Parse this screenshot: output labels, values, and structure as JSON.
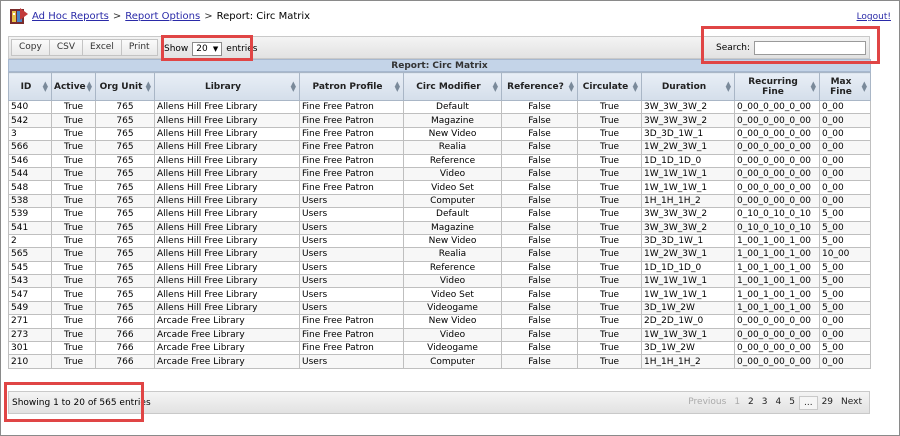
{
  "header": {
    "crumb_1": "Ad Hoc Reports",
    "sep_1": ">",
    "crumb_2": "Report Options",
    "sep_2": ">",
    "crumb_3": "Report: Circ Matrix",
    "logout": "Logout!"
  },
  "toolbar": {
    "buttons": [
      "Copy",
      "CSV",
      "Excel",
      "Print"
    ],
    "show_label": "Show",
    "entries_value": "20",
    "entries_label": "entries",
    "search_label": "Search:",
    "search_value": ""
  },
  "table": {
    "caption": "Report: Circ Matrix",
    "columns": [
      "ID",
      "Active",
      "Org Unit",
      "Library",
      "Patron Profile",
      "Circ Modifier",
      "Reference?",
      "Circulate",
      "Duration",
      "Recurring Fine",
      "Max Fine"
    ],
    "rows": [
      [
        "540",
        "True",
        "765",
        "Allens Hill Free Library",
        "Fine Free Patron",
        "Default",
        "False",
        "True",
        "3W_3W_3W_2",
        "0_00_0_00_0_00",
        "0_00"
      ],
      [
        "542",
        "True",
        "765",
        "Allens Hill Free Library",
        "Fine Free Patron",
        "Magazine",
        "False",
        "True",
        "3W_3W_3W_2",
        "0_00_0_00_0_00",
        "0_00"
      ],
      [
        "3",
        "True",
        "765",
        "Allens Hill Free Library",
        "Fine Free Patron",
        "New Video",
        "False",
        "True",
        "3D_3D_1W_1",
        "0_00_0_00_0_00",
        "0_00"
      ],
      [
        "566",
        "True",
        "765",
        "Allens Hill Free Library",
        "Fine Free Patron",
        "Realia",
        "False",
        "True",
        "1W_2W_3W_1",
        "0_00_0_00_0_00",
        "0_00"
      ],
      [
        "546",
        "True",
        "765",
        "Allens Hill Free Library",
        "Fine Free Patron",
        "Reference",
        "False",
        "True",
        "1D_1D_1D_0",
        "0_00_0_00_0_00",
        "0_00"
      ],
      [
        "544",
        "True",
        "765",
        "Allens Hill Free Library",
        "Fine Free Patron",
        "Video",
        "False",
        "True",
        "1W_1W_1W_1",
        "0_00_0_00_0_00",
        "0_00"
      ],
      [
        "548",
        "True",
        "765",
        "Allens Hill Free Library",
        "Fine Free Patron",
        "Video Set",
        "False",
        "True",
        "1W_1W_1W_1",
        "0_00_0_00_0_00",
        "0_00"
      ],
      [
        "538",
        "True",
        "765",
        "Allens Hill Free Library",
        "Users",
        "Computer",
        "False",
        "True",
        "1H_1H_1H_2",
        "0_00_0_00_0_00",
        "0_00"
      ],
      [
        "539",
        "True",
        "765",
        "Allens Hill Free Library",
        "Users",
        "Default",
        "False",
        "True",
        "3W_3W_3W_2",
        "0_10_0_10_0_10",
        "5_00"
      ],
      [
        "541",
        "True",
        "765",
        "Allens Hill Free Library",
        "Users",
        "Magazine",
        "False",
        "True",
        "3W_3W_3W_2",
        "0_10_0_10_0_10",
        "5_00"
      ],
      [
        "2",
        "True",
        "765",
        "Allens Hill Free Library",
        "Users",
        "New Video",
        "False",
        "True",
        "3D_3D_1W_1",
        "1_00_1_00_1_00",
        "5_00"
      ],
      [
        "565",
        "True",
        "765",
        "Allens Hill Free Library",
        "Users",
        "Realia",
        "False",
        "True",
        "1W_2W_3W_1",
        "1_00_1_00_1_00",
        "10_00"
      ],
      [
        "545",
        "True",
        "765",
        "Allens Hill Free Library",
        "Users",
        "Reference",
        "False",
        "True",
        "1D_1D_1D_0",
        "1_00_1_00_1_00",
        "5_00"
      ],
      [
        "543",
        "True",
        "765",
        "Allens Hill Free Library",
        "Users",
        "Video",
        "False",
        "True",
        "1W_1W_1W_1",
        "1_00_1_00_1_00",
        "5_00"
      ],
      [
        "547",
        "True",
        "765",
        "Allens Hill Free Library",
        "Users",
        "Video Set",
        "False",
        "True",
        "1W_1W_1W_1",
        "1_00_1_00_1_00",
        "5_00"
      ],
      [
        "549",
        "True",
        "765",
        "Allens Hill Free Library",
        "Users",
        "Videogame",
        "False",
        "True",
        "3D_1W_2W",
        "1_00_1_00_1_00",
        "5_00"
      ],
      [
        "271",
        "True",
        "766",
        "Arcade Free Library",
        "Fine Free Patron",
        "New Video",
        "False",
        "True",
        "2D_2D_1W_0",
        "0_00_0_00_0_00",
        "0_00"
      ],
      [
        "273",
        "True",
        "766",
        "Arcade Free Library",
        "Fine Free Patron",
        "Video",
        "False",
        "True",
        "1W_1W_3W_1",
        "0_00_0_00_0_00",
        "0_00"
      ],
      [
        "301",
        "True",
        "766",
        "Arcade Free Library",
        "Fine Free Patron",
        "Videogame",
        "False",
        "True",
        "3D_1W_2W",
        "0_00_0_00_0_00",
        "5_00"
      ],
      [
        "210",
        "True",
        "766",
        "Arcade Free Library",
        "Users",
        "Computer",
        "False",
        "True",
        "1H_1H_1H_2",
        "0_00_0_00_0_00",
        "0_00"
      ]
    ]
  },
  "footer": {
    "info": "Showing 1 to 20 of 565 entries",
    "pager": [
      "Previous",
      "1",
      "2",
      "3",
      "4",
      "5",
      "...",
      "29",
      "Next"
    ]
  },
  "colors": {
    "highlight": "#e04545",
    "link": "#2a2aa8",
    "caption_bg": "#c4d4e8"
  }
}
